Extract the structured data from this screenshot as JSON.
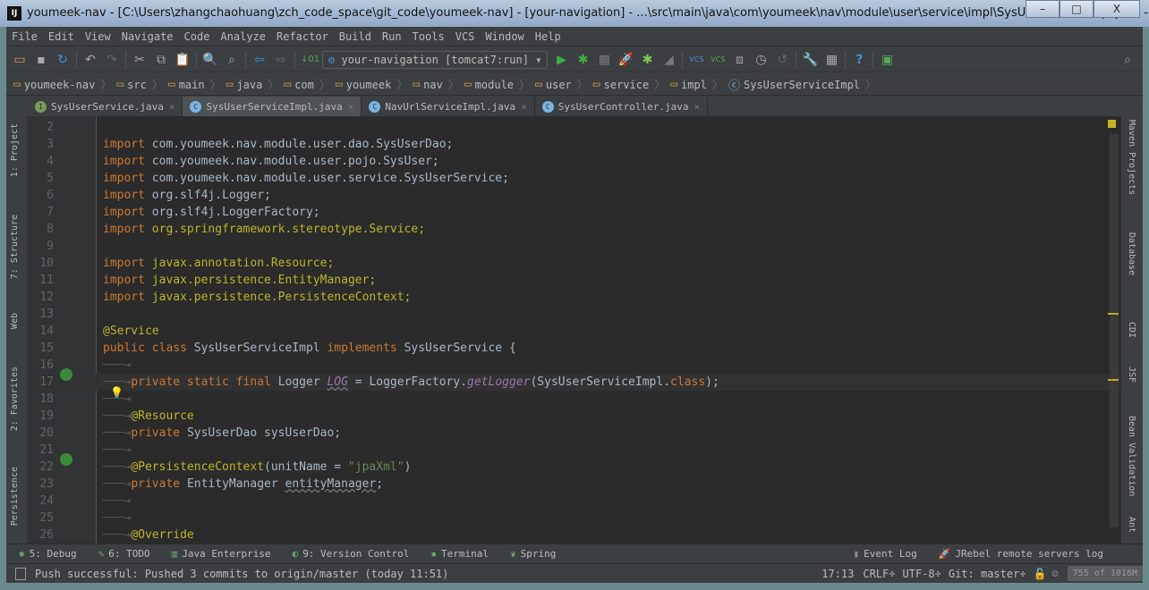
{
  "window": {
    "title": "youmeek-nav - [C:\\Users\\zhangchaohuang\\zch_code_space\\git_code\\youmeek-nav] - [your-navigation] - ...\\src\\main\\java\\com\\youmeek\\nav\\module\\user\\service\\impl\\SysUserServiceImpl.java - In...",
    "logo": "IJ",
    "minimize": "–",
    "maximize": "□",
    "close": "X"
  },
  "menu": [
    "File",
    "Edit",
    "View",
    "Navigate",
    "Code",
    "Analyze",
    "Refactor",
    "Build",
    "Run",
    "Tools",
    "VCS",
    "Window",
    "Help"
  ],
  "toolbar": {
    "run_config": "your-navigation [tomcat7:run]",
    "vcs_update": "VCS",
    "vcs_commit": "VCS",
    "help": "?"
  },
  "breadcrumb": [
    "youmeek-nav",
    "src",
    "main",
    "java",
    "com",
    "youmeek",
    "nav",
    "module",
    "user",
    "service",
    "impl",
    "SysUserServiceImpl"
  ],
  "tabs": [
    {
      "label": "SysUserService.java",
      "kind": "I"
    },
    {
      "label": "SysUserServiceImpl.java",
      "kind": "C",
      "active": true
    },
    {
      "label": "NavUrlServiceImpl.java",
      "kind": "C"
    },
    {
      "label": "SysUserController.java",
      "kind": "C"
    }
  ],
  "left_tools": [
    "1: Project",
    "7: Structure",
    "Web",
    "2: Favorites",
    "Persistence"
  ],
  "right_tools": [
    "Maven Projects",
    "Database",
    "CDI",
    "JSF",
    "Bean Validation",
    "Ant"
  ],
  "code": [
    {
      "n": "2",
      "t": []
    },
    {
      "n": "3",
      "t": [
        [
          "kw",
          "import "
        ],
        [
          "",
          "com.youmeek.nav.module.user.dao.SysUserDao;"
        ]
      ]
    },
    {
      "n": "4",
      "t": [
        [
          "kw",
          "import "
        ],
        [
          "",
          "com.youmeek.nav.module.user.pojo.SysUser;"
        ]
      ]
    },
    {
      "n": "5",
      "t": [
        [
          "kw",
          "import "
        ],
        [
          "",
          "com.youmeek.nav.module.user.service.SysUserService;"
        ]
      ]
    },
    {
      "n": "6",
      "t": [
        [
          "kw",
          "import "
        ],
        [
          "",
          "org.slf4j.Logger;"
        ]
      ]
    },
    {
      "n": "7",
      "t": [
        [
          "kw",
          "import "
        ],
        [
          "",
          "org.slf4j.LoggerFactory;"
        ]
      ]
    },
    {
      "n": "8",
      "t": [
        [
          "kw",
          "import "
        ],
        [
          "pk",
          "org.springframework.stereotype.Service;"
        ]
      ]
    },
    {
      "n": "9",
      "t": []
    },
    {
      "n": "10",
      "t": [
        [
          "kw",
          "import "
        ],
        [
          "pk",
          "javax.annotation.Resource;"
        ]
      ]
    },
    {
      "n": "11",
      "t": [
        [
          "kw",
          "import "
        ],
        [
          "pk",
          "javax.persistence.EntityManager;"
        ]
      ]
    },
    {
      "n": "12",
      "t": [
        [
          "kw",
          "import "
        ],
        [
          "pk",
          "javax.persistence.PersistenceContext;"
        ]
      ]
    },
    {
      "n": "13",
      "t": []
    },
    {
      "n": "14",
      "t": [
        [
          "an",
          "@Service"
        ]
      ]
    },
    {
      "n": "15",
      "t": [
        [
          "kw",
          "public class "
        ],
        [
          "",
          "SysUserServiceImpl "
        ],
        [
          "kw",
          "implements "
        ],
        [
          "",
          "SysUserService {"
        ]
      ]
    },
    {
      "n": "16",
      "t": [
        [
          "tabm",
          "───⇥"
        ]
      ]
    },
    {
      "n": "17",
      "t": [
        [
          "tabm",
          "───⇥"
        ],
        [
          "kw",
          "private static final "
        ],
        [
          "",
          "Logger "
        ],
        [
          "it und",
          "LOG"
        ],
        [
          "",
          " = LoggerFactory."
        ],
        [
          "it",
          "getLogger"
        ],
        [
          "",
          "(SysUserServiceImpl."
        ],
        [
          "kw",
          "class"
        ],
        [
          "",
          ");"
        ]
      ]
    },
    {
      "n": "18",
      "t": [
        [
          "tabm",
          "───⇥"
        ]
      ]
    },
    {
      "n": "19",
      "t": [
        [
          "tabm",
          "───⇥"
        ],
        [
          "an",
          "@Resource"
        ]
      ]
    },
    {
      "n": "20",
      "t": [
        [
          "tabm",
          "───⇥"
        ],
        [
          "kw",
          "private "
        ],
        [
          "",
          "SysUserDao sysUserDao;"
        ]
      ]
    },
    {
      "n": "21",
      "t": [
        [
          "tabm",
          "───⇥"
        ]
      ]
    },
    {
      "n": "22",
      "t": [
        [
          "tabm",
          "───⇥"
        ],
        [
          "an",
          "@PersistenceContext"
        ],
        [
          "",
          "(unitName = "
        ],
        [
          "st",
          "\"jpaXml\""
        ],
        [
          "",
          ")"
        ]
      ]
    },
    {
      "n": "23",
      "t": [
        [
          "tabm",
          "───⇥"
        ],
        [
          "kw",
          "private "
        ],
        [
          "",
          "EntityManager "
        ],
        [
          "und",
          "entityManager"
        ],
        [
          "",
          ";"
        ]
      ]
    },
    {
      "n": "24",
      "t": [
        [
          "tabm",
          "───⇥"
        ]
      ]
    },
    {
      "n": "25",
      "t": [
        [
          "tabm",
          "───⇥"
        ]
      ]
    },
    {
      "n": "26",
      "t": [
        [
          "tabm",
          "───⇥"
        ],
        [
          "an",
          "@Override"
        ]
      ]
    }
  ],
  "bottom_tools": [
    {
      "label": "5: Debug",
      "icon": "bug-icon"
    },
    {
      "label": "6: TODO",
      "icon": "todo-icon"
    },
    {
      "label": "Java Enterprise",
      "icon": "java-ee-icon"
    },
    {
      "label": "9: Version Control",
      "icon": "vcs-icon"
    },
    {
      "label": "Terminal",
      "icon": "terminal-icon"
    },
    {
      "label": "Spring",
      "icon": "spring-leaf-icon"
    }
  ],
  "bottom_right_tools": [
    {
      "label": "Event Log"
    },
    {
      "label": "JRebel remote servers log"
    }
  ],
  "status": {
    "message": "Push successful: Pushed 3 commits to origin/master (today 11:51)",
    "position": "17:13",
    "line_sep": "CRLF÷",
    "encoding": "UTF-8÷",
    "vcs": "Git: master÷",
    "memory": "755 of 1016M",
    "memory_fraction": 0.74
  }
}
